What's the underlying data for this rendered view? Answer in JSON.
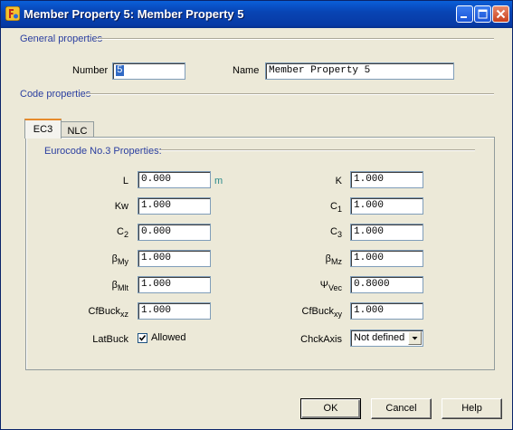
{
  "window": {
    "title": "Member Property 5: Member Property 5"
  },
  "general": {
    "section_label": "General properties",
    "number_label": "Number",
    "number_value": "5",
    "name_label": "Name",
    "name_value": "Member Property 5"
  },
  "code": {
    "section_label": "Code properties"
  },
  "tabs": [
    {
      "label": "EC3"
    },
    {
      "label": "NLC"
    }
  ],
  "ec3": {
    "section_label": "Eurocode No.3 Properties:",
    "fields": {
      "L": {
        "label": "L",
        "value": "0.000",
        "unit": "m"
      },
      "Kw": {
        "label": "Kw",
        "value": "1.000"
      },
      "C2": {
        "label": "C",
        "sub": "2",
        "value": "0.000"
      },
      "BetaMy": {
        "label": "β",
        "sub": "My",
        "value": "1.000"
      },
      "BetaMlt": {
        "label": "β",
        "sub": "Mlt",
        "value": "1.000"
      },
      "CfBuckXz": {
        "label": "CfBuck",
        "sub": "xz",
        "value": "1.000"
      },
      "K": {
        "label": "K",
        "value": "1.000"
      },
      "C1": {
        "label": "C",
        "sub": "1",
        "value": "1.000"
      },
      "C3": {
        "label": "C",
        "sub": "3",
        "value": "1.000"
      },
      "BetaMz": {
        "label": "β",
        "sub": "Mz",
        "value": "1.000"
      },
      "PsiVec": {
        "label": "Ψ",
        "sub": "Vec",
        "value": "0.8000"
      },
      "CfBuckXy": {
        "label": "CfBuck",
        "sub": "xy",
        "value": "1.000"
      }
    },
    "latbuck": {
      "label": "LatBuck",
      "checkbox_label": "Allowed",
      "checked": true
    },
    "chckaxis": {
      "label": "ChckAxis",
      "selected": "Not defined"
    }
  },
  "buttons": {
    "ok": "OK",
    "cancel": "Cancel",
    "help": "Help"
  },
  "colors": {
    "title_bar": "#0844b4",
    "section_text": "#2b3fa0",
    "unit_text": "#2b8a8a",
    "tab_accent": "#e68b2c"
  }
}
